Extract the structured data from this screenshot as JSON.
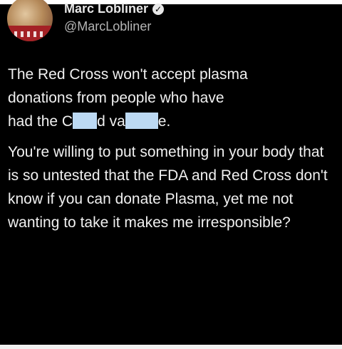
{
  "author": {
    "name": "Marc Lobliner",
    "handle": "@MarcLobliner",
    "verified_glyph": "✓"
  },
  "tweet": {
    "line1": "The Red Cross won't accept plasma",
    "line2": "donations from people who have",
    "line3_a": "had the C",
    "line3_b": "d va",
    "line3_c": "e.",
    "paragraph2": "You're willing to put something in your body that is so untested that the FDA and Red Cross don't know if you can donate Plasma, yet me not wanting to take it makes me irresponsible?"
  },
  "colors": {
    "background": "#000000",
    "text": "#f0f0f0",
    "handle": "#b5b5b5",
    "redaction": "#bcd9f3"
  },
  "icons": {
    "avatar": "avatar-photo",
    "verified": "verified-badge-icon"
  }
}
